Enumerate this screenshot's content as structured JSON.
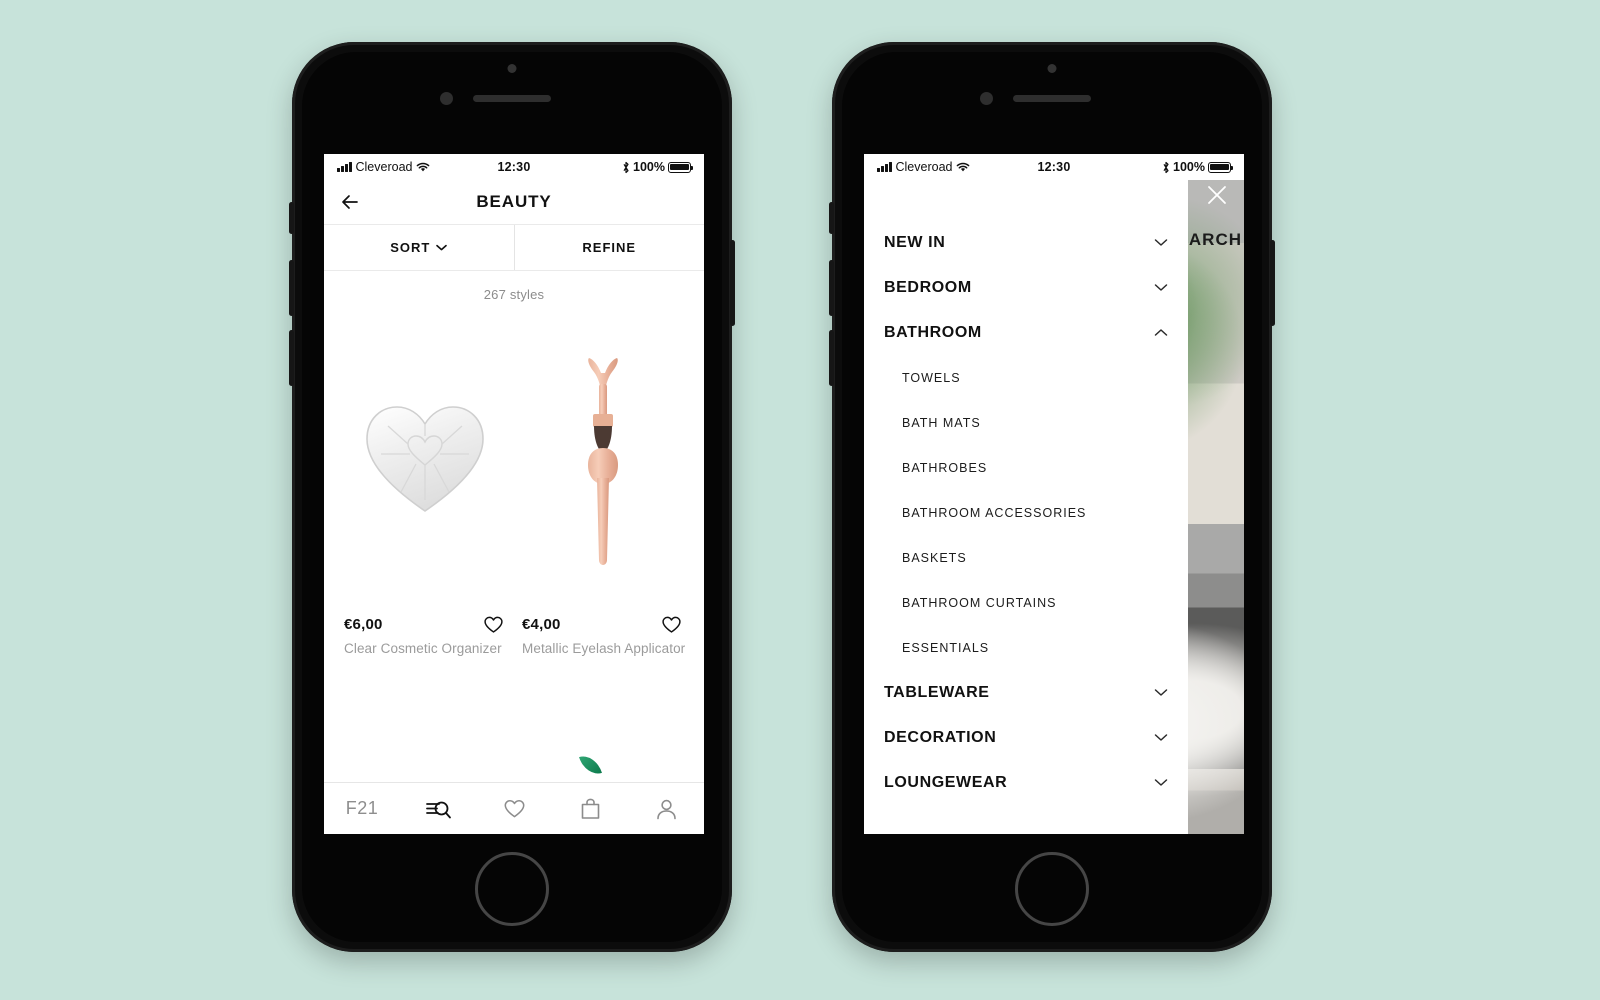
{
  "background_color": "#c7e3da",
  "left_phone": {
    "status_bar": {
      "carrier": "Cleveroad",
      "time": "12:30",
      "battery_percent": "100%",
      "signal_icon": "signal-bars-icon",
      "wifi_icon": "wifi-icon",
      "bluetooth_icon": "bluetooth-icon",
      "battery_icon": "battery-full-icon"
    },
    "header": {
      "back_icon": "back-arrow-icon",
      "title": "BEAUTY"
    },
    "filter_bar": {
      "sort_label": "SORT",
      "sort_chevron_icon": "chevron-down-icon",
      "refine_label": "REFINE"
    },
    "results_count": "267 styles",
    "products": [
      {
        "price": "€6,00",
        "name": "Clear Cosmetic Organizer",
        "image": "clear-heart-cosmetic-organizer",
        "wishlist_icon": "heart-outline-icon"
      },
      {
        "price": "€4,00",
        "name": "Metallic Eyelash Applicator",
        "image": "rose-gold-eyelash-applicator",
        "wishlist_icon": "heart-outline-icon"
      }
    ],
    "tab_bar": [
      {
        "label": "F21",
        "icon": "brand-f21-logo",
        "active": false
      },
      {
        "label": "",
        "icon": "search-filter-icon",
        "active": true
      },
      {
        "label": "",
        "icon": "heart-outline-icon",
        "active": false
      },
      {
        "label": "",
        "icon": "shopping-bag-icon",
        "active": false
      },
      {
        "label": "",
        "icon": "person-account-icon",
        "active": false
      }
    ]
  },
  "right_phone": {
    "status_bar": {
      "carrier": "Cleveroad",
      "time": "12:30",
      "battery_percent": "100%",
      "signal_icon": "signal-bars-icon",
      "wifi_icon": "wifi-icon",
      "bluetooth_icon": "bluetooth-icon",
      "battery_icon": "battery-full-icon"
    },
    "behind_layer": {
      "close_icon": "close-x-icon",
      "search_label": "ARCH",
      "photo_top": "potted-plant-in-wicker-basket",
      "photo_bottom": "bedroom-with-white-pillows"
    },
    "drawer": {
      "items": [
        {
          "label": "NEW IN",
          "expanded": false,
          "chevron": "chevron-down-icon"
        },
        {
          "label": "BEDROOM",
          "expanded": false,
          "chevron": "chevron-down-icon"
        },
        {
          "label": "BATHROOM",
          "expanded": true,
          "chevron": "chevron-up-icon"
        }
      ],
      "bathroom_subitems": [
        "TOWELS",
        "BATH MATS",
        "BATHROBES",
        "BATHROOM ACCESSORIES",
        "BASKETS",
        "BATHROOM CURTAINS",
        "ESSENTIALS"
      ],
      "items_after": [
        {
          "label": "TABLEWARE",
          "expanded": false,
          "chevron": "chevron-down-icon"
        },
        {
          "label": "DECORATION",
          "expanded": false,
          "chevron": "chevron-down-icon"
        },
        {
          "label": "LOUNGEWEAR",
          "expanded": false,
          "chevron": "chevron-down-icon"
        }
      ]
    }
  }
}
